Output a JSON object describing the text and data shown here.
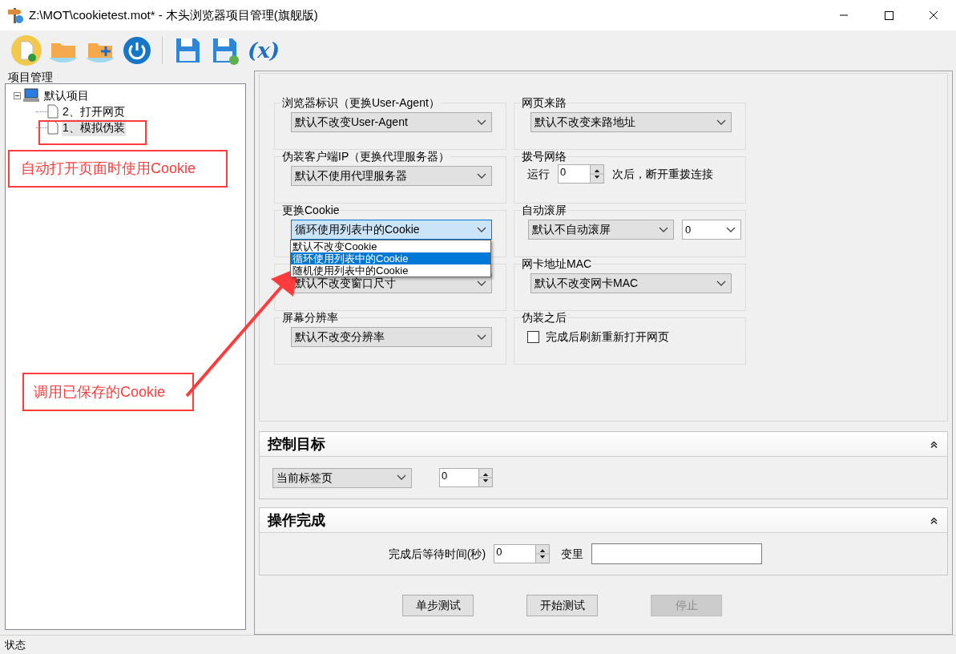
{
  "window": {
    "title": "Z:\\MOT\\cookietest.mot* - 木头浏览器项目管理(旗舰版)"
  },
  "toolbar": {
    "variable_button": "(x)"
  },
  "project_panel": {
    "title": "项目管理",
    "tree": [
      {
        "label": "默认项目",
        "expanded": true,
        "children": [
          {
            "label": "2、打开网页",
            "selected": false
          },
          {
            "label": "1、模拟伪装",
            "selected": true
          }
        ]
      }
    ]
  },
  "settings": [
    {
      "kind": "select",
      "label": "浏览器标识（更换User-Agent）",
      "value": "默认不改变User-Agent"
    },
    {
      "kind": "select",
      "label": "网页来路",
      "value": "默认不改变来路地址"
    },
    {
      "kind": "select",
      "label": "伪装客户端IP（更换代理服务器）",
      "value": "默认不使用代理服务器"
    },
    {
      "kind": "spinner",
      "label": "拨号网络",
      "prefix": "运行",
      "value": "0",
      "suffix": "次后，断开重拨连接"
    },
    {
      "kind": "select",
      "label": "更换Cookie",
      "value": "循环使用列表中的Cookie",
      "open": true,
      "options": [
        {
          "label": "默认不改变Cookie",
          "selected": false
        },
        {
          "label": "循环使用列表中的Cookie",
          "selected": true
        },
        {
          "label": "随机使用列表中的Cookie",
          "selected": false
        }
      ]
    },
    {
      "kind": "select_pair",
      "label": "自动滚屏",
      "value": "默认不自动滚屏",
      "value2": "0"
    },
    {
      "kind": "select",
      "value": "默认不改变窗口尺寸"
    },
    {
      "kind": "select",
      "label": "网卡地址MAC",
      "value": "默认不改变网卡MAC"
    },
    {
      "kind": "select",
      "label": "屏幕分辨率",
      "value": "默认不改变分辨率"
    },
    {
      "kind": "checkbox",
      "label": "伪装之后",
      "text": "完成后刷新重新打开网页",
      "checked": false
    }
  ],
  "control_target": {
    "title": "控制目标",
    "select": "当前标签页",
    "spinner": "0"
  },
  "completion": {
    "title": "操作完成",
    "wait_label": "完成后等待时间(秒)",
    "wait_value": "0",
    "variable_label": "变里"
  },
  "buttons": [
    {
      "label": "单步测试",
      "disabled": false
    },
    {
      "label": "开始测试",
      "disabled": false
    },
    {
      "label": "停止",
      "disabled": true
    }
  ],
  "annotations": [
    {
      "text": "自动打开页面时使用Cookie"
    },
    {
      "text": "调用已保存的Cookie"
    }
  ],
  "status_bar": {
    "text": "状态"
  }
}
